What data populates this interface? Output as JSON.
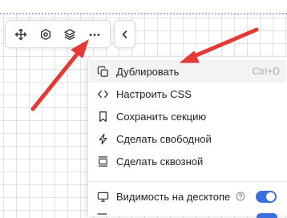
{
  "toolbar": {
    "buttons": [
      {
        "name": "move-icon"
      },
      {
        "name": "settings-icon"
      },
      {
        "name": "layers-icon"
      },
      {
        "name": "more-icon"
      }
    ],
    "back_icon": "chevron-left-icon"
  },
  "menu": {
    "items": [
      {
        "icon": "duplicate-icon",
        "label": "Дублировать",
        "shortcut": "Ctrl+D"
      },
      {
        "icon": "code-icon",
        "label": "Настроить CSS"
      },
      {
        "icon": "bookmark-icon",
        "label": "Сохранить секцию"
      },
      {
        "icon": "lightning-icon",
        "label": "Сделать свободной"
      },
      {
        "icon": "pin-icon",
        "label": "Сделать сквозной"
      }
    ],
    "visibility": {
      "icon": "desktop-icon",
      "label": "Видимость на десктопе",
      "help_icon": "help-icon",
      "enabled": true
    }
  },
  "colors": {
    "accent": "#3b6fe0",
    "arrow": "#e53935"
  }
}
